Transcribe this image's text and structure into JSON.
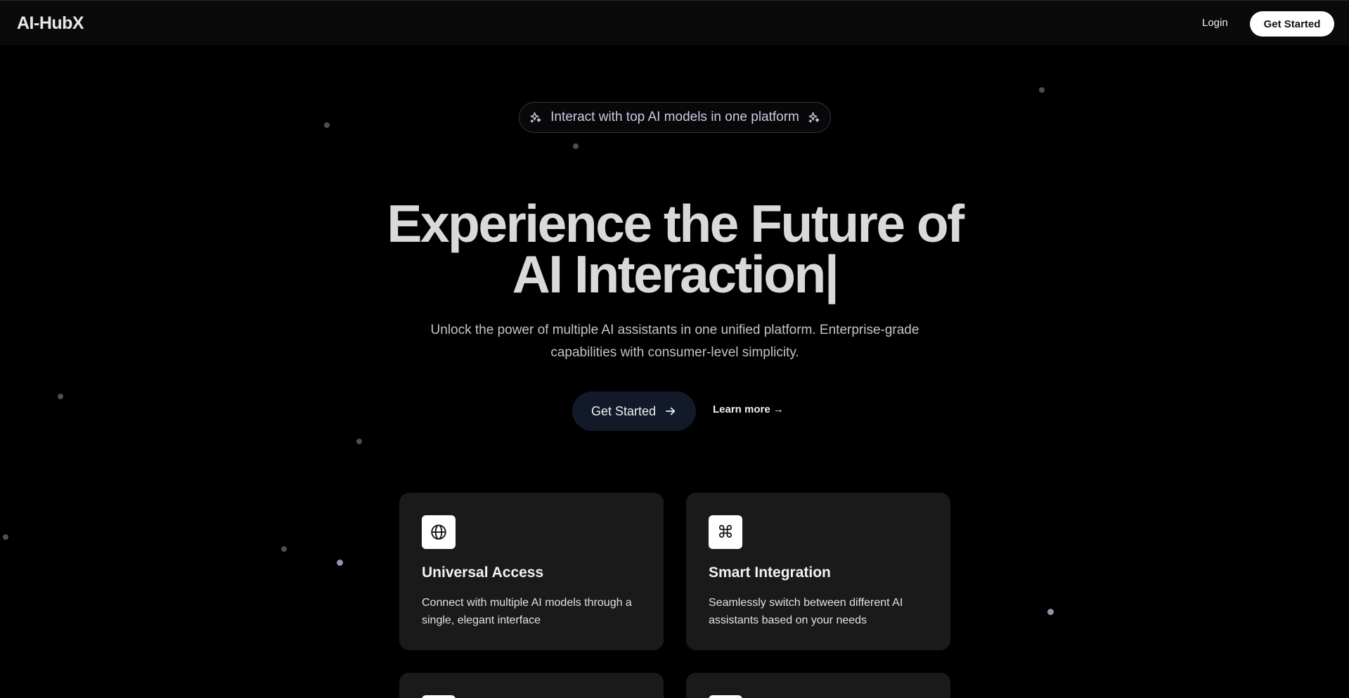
{
  "header": {
    "logo": "AI-HubX",
    "login_label": "Login",
    "cta_label": "Get Started"
  },
  "badge": {
    "text": "Interact with top AI models in one platform",
    "icon": "sparkles-icon"
  },
  "hero": {
    "title_line1": "Experience the Future of",
    "title_line2": "AI Interaction|",
    "subtitle": "Unlock the power of multiple AI assistants in one unified platform. Enterprise-grade capabilities with consumer-level simplicity.",
    "primary_cta": "Get Started",
    "primary_cta_icon": "arrow-right-icon",
    "secondary_cta": "Learn more →"
  },
  "features": [
    {
      "icon": "globe-icon",
      "title": "Universal Access",
      "description": "Connect with multiple AI models through a single, elegant interface"
    },
    {
      "icon": "command-icon",
      "icon_glyph": "⌘",
      "title": "Smart Integration",
      "description": "Seamlessly switch between different AI assistants based on your needs"
    }
  ],
  "colors": {
    "background": "#000000",
    "header_bg": "#0a0a0b",
    "card_bg": "#1a1a1a",
    "primary_button_bg": "#121a29",
    "nav_cta_bg": "#ffffff",
    "heading": "#d9d9d9",
    "badge_text": "#c9cbe0"
  }
}
